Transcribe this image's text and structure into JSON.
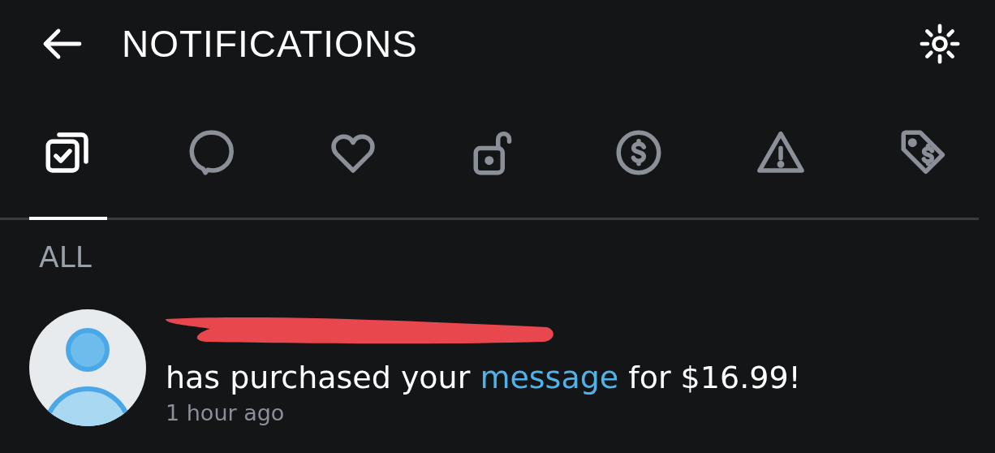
{
  "header": {
    "title": "NOTIFICATIONS"
  },
  "tabs": [
    {
      "kind": "all",
      "selected": true
    },
    {
      "kind": "comments",
      "selected": false
    },
    {
      "kind": "likes",
      "selected": false
    },
    {
      "kind": "subscriptions",
      "selected": false
    },
    {
      "kind": "tips",
      "selected": false
    },
    {
      "kind": "warnings",
      "selected": false
    },
    {
      "kind": "promotions",
      "selected": false
    }
  ],
  "section": {
    "label": "ALL"
  },
  "notifications": [
    {
      "name_redacted": true,
      "text_before": "has purchased your",
      "link": "message",
      "text_after": "for $16.99!",
      "time": "1 hour ago"
    }
  ]
}
